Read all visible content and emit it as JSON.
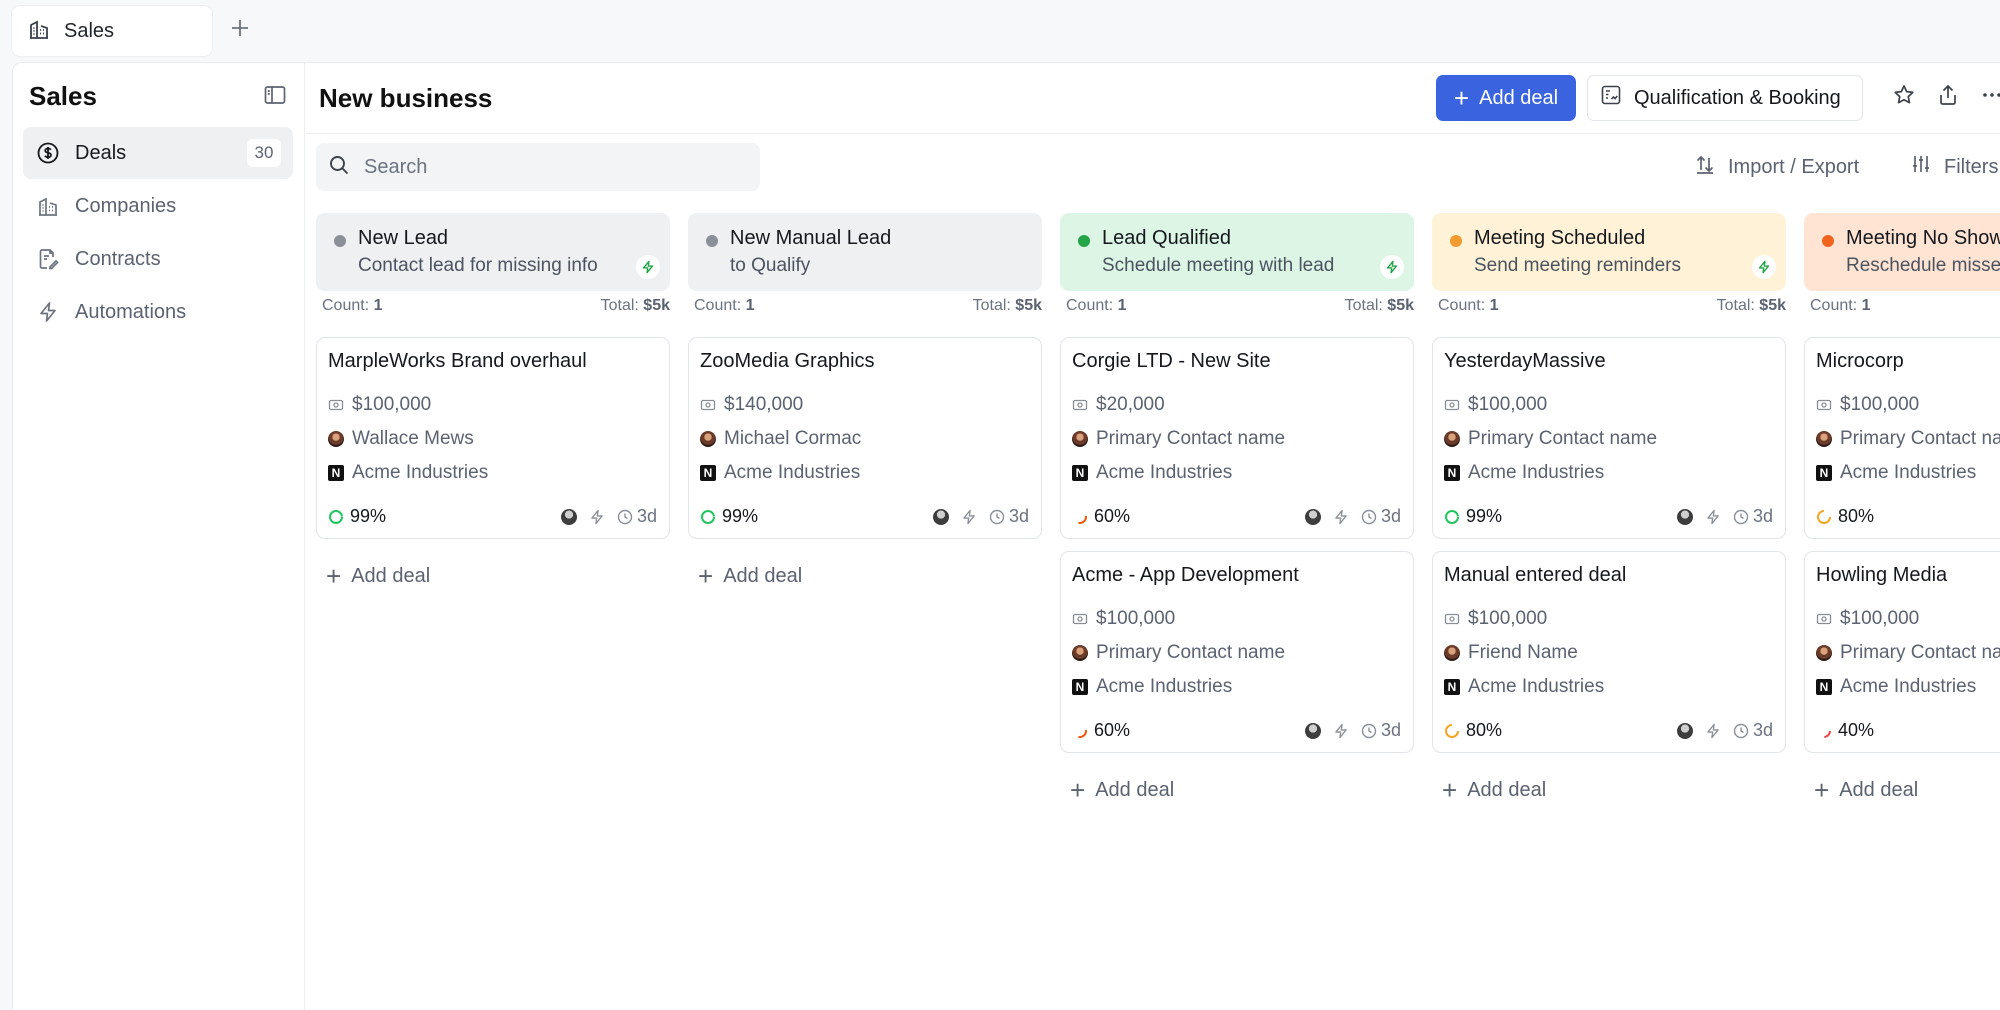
{
  "tabs": [
    {
      "label": "Sales"
    }
  ],
  "sidebar": {
    "title": "Sales",
    "items": [
      {
        "label": "Deals",
        "count": "30",
        "icon": "dollar-circle-icon",
        "active": true
      },
      {
        "label": "Companies",
        "icon": "building-icon"
      },
      {
        "label": "Contracts",
        "icon": "contract-icon"
      },
      {
        "label": "Automations",
        "icon": "bolt-icon"
      }
    ]
  },
  "header": {
    "title": "New business",
    "add_deal_label": "Add deal",
    "pipeline_label": "Qualification & Booking"
  },
  "toolbar": {
    "search_placeholder": "Search",
    "import_export_label": "Import / Export",
    "filters_label": "Filters"
  },
  "colors": {
    "accent": "#3a63e0",
    "gray_dot": "#8a8f98",
    "green_dot": "#22a447",
    "orange_dot": "#f29a2e",
    "red_orange_dot": "#f2641e"
  },
  "columns": [
    {
      "title": "New Lead",
      "subtitle": "Contact lead for missing info",
      "count_label": "Count:",
      "count": "1",
      "total_label": "Total:",
      "total": "$5k",
      "add_label": "Add deal",
      "cards": [
        {
          "title": "MarpleWorks Brand overhaul",
          "amount": "$100,000",
          "contact": "Wallace Mews",
          "company": "Acme Industries",
          "probability": "99%",
          "age": "3d"
        }
      ]
    },
    {
      "title": "New Manual Lead",
      "subtitle": "to Qualify",
      "count_label": "Count:",
      "count": "1",
      "total_label": "Total:",
      "total": "$5k",
      "add_label": "Add deal",
      "cards": [
        {
          "title": "ZooMedia Graphics",
          "amount": "$140,000",
          "contact": "Michael Cormac",
          "company": "Acme Industries",
          "probability": "99%",
          "age": "3d"
        }
      ]
    },
    {
      "title": "Lead Qualified",
      "subtitle": "Schedule meeting with lead",
      "count_label": "Count:",
      "count": "1",
      "total_label": "Total:",
      "total": "$5k",
      "add_label": "Add deal",
      "cards": [
        {
          "title": "Corgie LTD - New Site",
          "amount": "$20,000",
          "contact": "Primary Contact name",
          "company": "Acme Industries",
          "probability": "60%",
          "age": "3d"
        },
        {
          "title": "Acme - App Development",
          "amount": "$100,000",
          "contact": "Primary Contact name",
          "company": "Acme Industries",
          "probability": "60%",
          "age": "3d"
        }
      ]
    },
    {
      "title": "Meeting Scheduled",
      "subtitle": "Send meeting reminders",
      "count_label": "Count:",
      "count": "1",
      "total_label": "Total:",
      "total": "$5k",
      "add_label": "Add deal",
      "cards": [
        {
          "title": "YesterdayMassive",
          "amount": "$100,000",
          "contact": "Primary Contact name",
          "company": "Acme Industries",
          "probability": "99%",
          "age": "3d"
        },
        {
          "title": "Manual entered deal",
          "amount": "$100,000",
          "contact": "Friend Name",
          "company": "Acme Industries",
          "probability": "80%",
          "age": "3d"
        }
      ]
    },
    {
      "title": "Meeting No Show",
      "subtitle": "Reschedule missed meeting",
      "count_label": "Count:",
      "count": "1",
      "add_label": "Add deal",
      "cards": [
        {
          "title": "Microcorp",
          "amount": "$100,000",
          "contact": "Primary Contact name",
          "company": "Acme Industries",
          "probability": "80%"
        },
        {
          "title": "Howling Media",
          "amount": "$100,000",
          "contact": "Primary Contact name",
          "company": "Acme Industries",
          "probability": "40%"
        }
      ]
    }
  ]
}
